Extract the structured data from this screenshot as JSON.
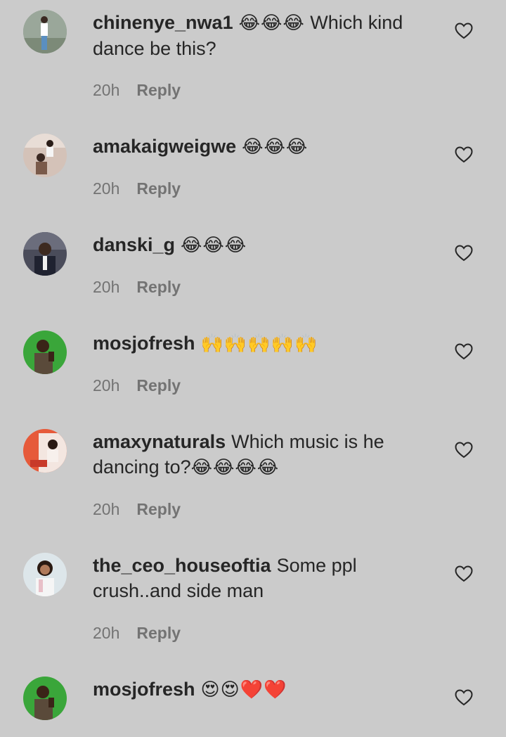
{
  "comments": [
    {
      "username": "chinenye_nwa1",
      "emoji_prefix": "😂😂😂",
      "text": "Which kind dance be this?",
      "emoji_suffix": "",
      "time": "20h",
      "reply_label": "Reply",
      "avatar_bg": "#8a9a8a"
    },
    {
      "username": "amakaigweigwe",
      "emoji_prefix": "😂😂😂",
      "text": "",
      "emoji_suffix": "",
      "time": "20h",
      "reply_label": "Reply",
      "avatar_bg": "#c9b3a8"
    },
    {
      "username": "danski_g",
      "emoji_prefix": "😂😂😂",
      "text": "",
      "emoji_suffix": "",
      "time": "20h",
      "reply_label": "Reply",
      "avatar_bg": "#5b5d6b"
    },
    {
      "username": "mosjofresh",
      "emoji_prefix": "🙌🙌🙌🙌🙌",
      "text": "",
      "emoji_suffix": "",
      "time": "20h",
      "reply_label": "Reply",
      "avatar_bg": "#3aa63a"
    },
    {
      "username": "amaxynaturals",
      "emoji_prefix": "",
      "text": "Which music is he dancing to?",
      "emoji_suffix": "😂😂😂😂",
      "time": "20h",
      "reply_label": "Reply",
      "avatar_bg": "#e65a3a"
    },
    {
      "username": "the_ceo_houseoftia",
      "emoji_prefix": "",
      "text": "Some ppl crush..and side man",
      "emoji_suffix": "",
      "time": "20h",
      "reply_label": "Reply",
      "avatar_bg": "#dde6ea"
    },
    {
      "username": "mosjofresh",
      "emoji_prefix": "😍😍❤️❤️",
      "text": "",
      "emoji_suffix": "",
      "time": "",
      "reply_label": "",
      "avatar_bg": "#3aa63a"
    }
  ]
}
